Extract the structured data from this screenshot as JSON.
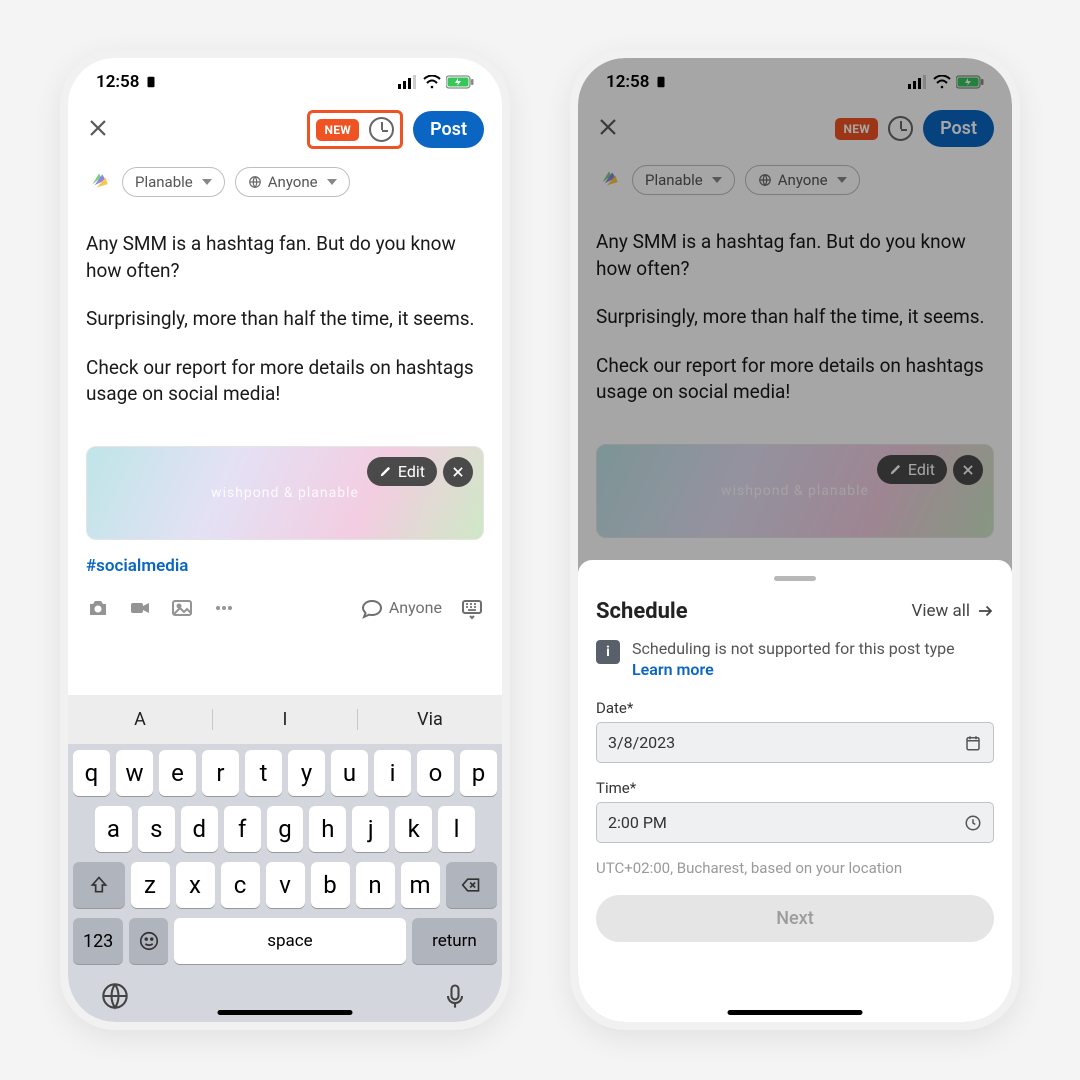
{
  "status": {
    "time": "12:58"
  },
  "header": {
    "new_badge": "NEW",
    "post_label": "Post"
  },
  "composer": {
    "account_pill": "Planable",
    "visibility_pill": "Anyone",
    "paragraphs": [
      "Any SMM is a hashtag fan. But do you know how often?",
      "Surprisingly, more than half the time, it seems.",
      "Check our report for more details on hashtags usage on social media!"
    ],
    "hashtag": "#socialmedia",
    "attachment_strip": "wishpond   &   planable",
    "edit_label": "Edit"
  },
  "toolbar": {
    "anyone_label": "Anyone"
  },
  "keyboard": {
    "suggestions": [
      "A",
      "I",
      "Via"
    ],
    "row1": [
      "q",
      "w",
      "e",
      "r",
      "t",
      "y",
      "u",
      "i",
      "o",
      "p"
    ],
    "row2": [
      "a",
      "s",
      "d",
      "f",
      "g",
      "h",
      "j",
      "k",
      "l"
    ],
    "row3": [
      "z",
      "x",
      "c",
      "v",
      "b",
      "n",
      "m"
    ],
    "n123": "123",
    "space": "space",
    "return": "return"
  },
  "sheet": {
    "title": "Schedule",
    "view_all": "View all",
    "info_text": "Scheduling is not supported for this post type",
    "learn_more": "Learn more",
    "date_label": "Date*",
    "date_value": "3/8/2023",
    "time_label": "Time*",
    "time_value": "2:00 PM",
    "timezone": "UTC+02:00, Bucharest, based on your location",
    "next": "Next"
  }
}
